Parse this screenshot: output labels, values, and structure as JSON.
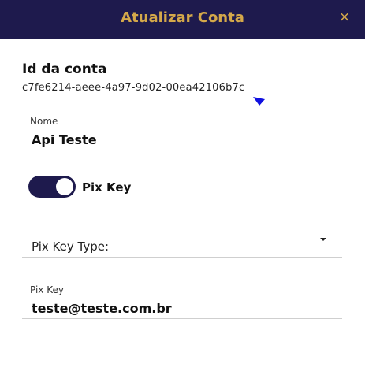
{
  "dialog": {
    "title": "Atualizar Conta",
    "close_label": "×"
  },
  "account": {
    "heading": "Id da conta",
    "id": "c7fe6214-aeee-4a97-9d02-00ea42106b7c"
  },
  "fields": {
    "nome": {
      "label": "Nome",
      "value": "Api Teste"
    },
    "pix_toggle": {
      "label": "Pix Key",
      "on": true
    },
    "pix_key_type": {
      "placeholder": "Pix Key Type:"
    },
    "pix_key": {
      "label": "Pix Key",
      "value": "teste@teste.com.br"
    }
  },
  "colors": {
    "header_bg": "#1e1a4d",
    "accent": "#d4a84a",
    "toggle_on": "#1e1a4d"
  },
  "icons": {
    "close": "close-icon",
    "dropdown": "chevron-down-icon"
  }
}
